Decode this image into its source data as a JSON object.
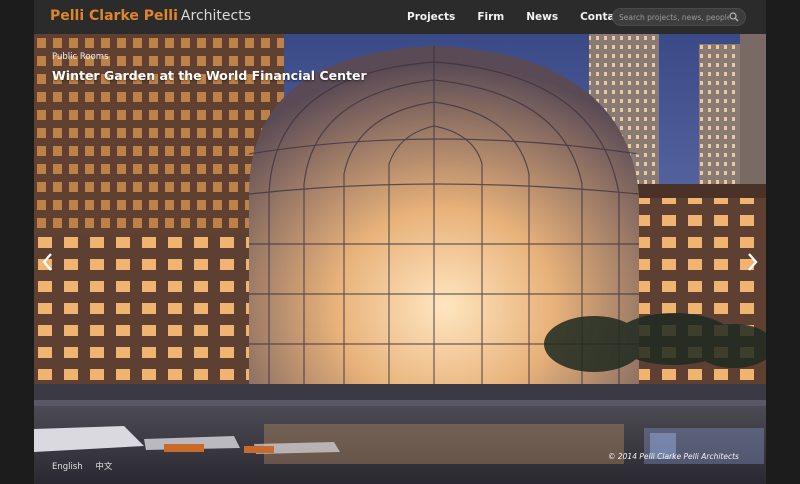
{
  "header": {
    "logo_brand": "Pelli Clarke Pelli",
    "logo_suffix": "Architects",
    "nav": [
      "Projects",
      "Firm",
      "News",
      "Contacts"
    ],
    "search_placeholder": "Search projects, news, people"
  },
  "slide": {
    "category": "Public Rooms",
    "title": "Winter Garden at the World Financial Center"
  },
  "footer": {
    "languages": [
      "English",
      "中文"
    ],
    "copyright": "© 2014 Pelli Clarke Pelli Architects"
  },
  "colors": {
    "brand": "#e0862a",
    "topbar": "#2b2b2b"
  },
  "icons": {
    "search": "search-icon",
    "prev": "chevron-left-icon",
    "next": "chevron-right-icon"
  }
}
